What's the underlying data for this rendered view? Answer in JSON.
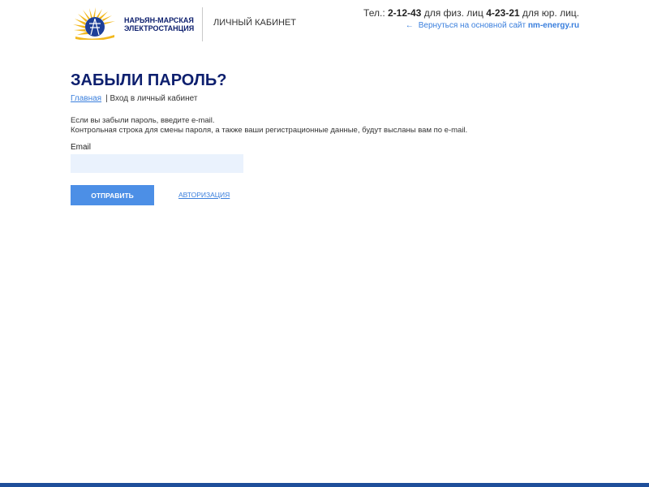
{
  "header": {
    "company_line1": "НАРЬЯН-МАРСКАЯ",
    "company_line2": "ЭЛЕКТРОСТАНЦИЯ",
    "cabinet_label": "ЛИЧНЫЙ КАБИНЕТ",
    "phone": {
      "prefix": "Тел.: ",
      "individuals_number": "2-12-43",
      "individuals_label": " для физ. лиц ",
      "legal_number": "4-23-21",
      "legal_label": " для юр. лиц."
    },
    "back_link": {
      "text": "Вернуться на основной сайт ",
      "domain": "nm-energy.ru"
    }
  },
  "main": {
    "title": "ЗАБЫЛИ ПАРОЛЬ?",
    "breadcrumb": {
      "home": "Главная",
      "current": "| Вход в личный кабинет"
    },
    "info_line1": "Если вы забыли пароль, введите e-mail.",
    "info_line2": "Контрольная строка для смены пароля, а также ваши регистрационные данные, будут высланы вам по e-mail."
  },
  "form": {
    "email_label": "Email",
    "email_value": "",
    "email_placeholder": "",
    "submit_label": "ОТПРАВИТЬ",
    "auth_link": "АВТОРИЗАЦИЯ"
  },
  "colors": {
    "brand_navy": "#0d1f6e",
    "link_blue": "#3a7fdd",
    "button_blue": "#4c8fe6",
    "input_bg": "#eaf2fd",
    "footer_bar": "#1e4e9a",
    "logo_sun": "#f2b81e"
  },
  "icons": {
    "logo": "sun-power-tower-logo",
    "back": "arrow-left-icon"
  }
}
